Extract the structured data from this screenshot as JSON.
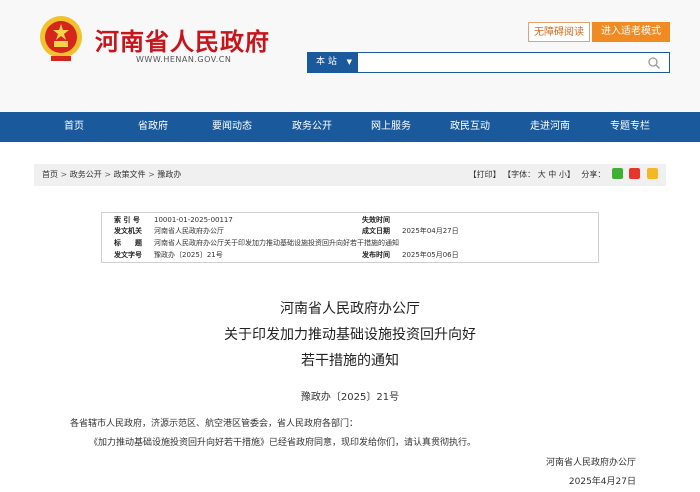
{
  "header": {
    "site_title": "河南省人民政府",
    "site_domain": "WWW.HENAN.GOV.CN",
    "accessibility_label": "无障碍阅读",
    "elder_mode_label": "进入适老模式",
    "search_scope": "本 站",
    "search_placeholder": ""
  },
  "nav": {
    "items": [
      "首页",
      "省政府",
      "要闻动态",
      "政务公开",
      "网上服务",
      "政民互动",
      "走进河南",
      "专题专栏"
    ]
  },
  "breadcrumb": {
    "items": [
      "首页",
      "政务公开",
      "政策文件",
      "豫政办"
    ],
    "sep": ">"
  },
  "tools": {
    "print": "【打印】",
    "font_label": "【字体：",
    "font_big": "大",
    "font_mid": "中",
    "font_small": "小",
    "font_end": "】",
    "share_label": "分享："
  },
  "meta": {
    "index_label": "索 引 号",
    "index_value": "10001-01-2025-00117",
    "agency_label": "发文机关",
    "agency_value": "河南省人民政府办公厅",
    "subject_label": "标　　题",
    "subject_value": "河南省人民政府办公厅关于印发加力推动基础设施投资回升向好若干措施的通知",
    "docno_label": "发文字号",
    "docno_value": "豫政办〔2025〕21号",
    "expiry_label": "失效时间",
    "expiry_value": "",
    "written_label": "成文日期",
    "written_value": "2025年04月27日",
    "published_label": "发布时间",
    "published_value": "2025年05月06日"
  },
  "document": {
    "title_line1": "河南省人民政府办公厅",
    "title_line2": "关于印发加力推动基础设施投资回升向好",
    "title_line3": "若干措施的通知",
    "number": "豫政办〔2025〕21号",
    "salutation": "各省辖市人民政府，济源示范区、航空港区管委会，省人民政府各部门：",
    "paragraph1": "《加力推动基础设施投资回升向好若干措施》已经省政府同意，现印发给你们，请认真贯彻执行。",
    "signer": "河南省人民政府办公厅",
    "date": "2025年4月27日"
  },
  "colors": {
    "brand_red": "#c8141b",
    "nav_blue": "#1a5a9c",
    "elder_orange": "#f08a22"
  }
}
